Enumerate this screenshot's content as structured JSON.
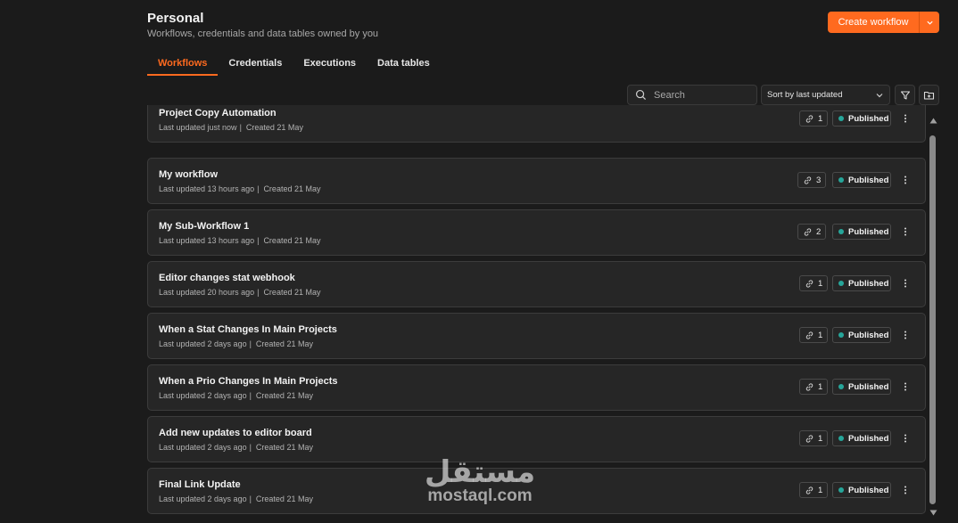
{
  "header": {
    "title": "Personal",
    "subtitle": "Workflows, credentials and data tables owned by you",
    "create_button": "Create workflow"
  },
  "tabs": [
    {
      "label": "Workflows",
      "active": true
    },
    {
      "label": "Credentials",
      "active": false
    },
    {
      "label": "Executions",
      "active": false
    },
    {
      "label": "Data tables",
      "active": false
    }
  ],
  "toolbar": {
    "search_placeholder": "Search",
    "sort_value": "Sort by last updated"
  },
  "workflows": [
    {
      "name": "Project Copy Automation",
      "updated": "Last updated just now",
      "created": "Created 21 May",
      "links": "1",
      "status": "Published"
    },
    {
      "name": "My workflow",
      "updated": "Last updated 13 hours ago",
      "created": "Created 21 May",
      "links": "3",
      "status": "Published"
    },
    {
      "name": "My Sub-Workflow 1",
      "updated": "Last updated 13 hours ago",
      "created": "Created 21 May",
      "links": "2",
      "status": "Published"
    },
    {
      "name": "Editor changes stat webhook",
      "updated": "Last updated 20 hours ago",
      "created": "Created 21 May",
      "links": "1",
      "status": "Published"
    },
    {
      "name": "When a Stat Changes In Main Projects",
      "updated": "Last updated 2 days ago",
      "created": "Created 21 May",
      "links": "1",
      "status": "Published"
    },
    {
      "name": "When a Prio Changes In Main Projects",
      "updated": "Last updated 2 days ago",
      "created": "Created 21 May",
      "links": "1",
      "status": "Published"
    },
    {
      "name": "Add new updates to editor board",
      "updated": "Last updated 2 days ago",
      "created": "Created 21 May",
      "links": "1",
      "status": "Published"
    },
    {
      "name": "Final Link Update",
      "updated": "Last updated 2 days ago",
      "created": "Created 21 May",
      "links": "1",
      "status": "Published"
    }
  ],
  "watermark": {
    "arabic": "مستقل",
    "latin": "mostaql.com"
  },
  "colors": {
    "accent": "#ff6a1f",
    "published_dot": "#26a69a",
    "background": "#1b1b1b",
    "card": "#262626"
  },
  "icons": {
    "search": "search-icon",
    "filter": "filter-icon",
    "folder": "folder-plus-icon",
    "link": "link-icon",
    "kebab": "more-vertical-icon",
    "chevron": "chevron-down-icon"
  }
}
